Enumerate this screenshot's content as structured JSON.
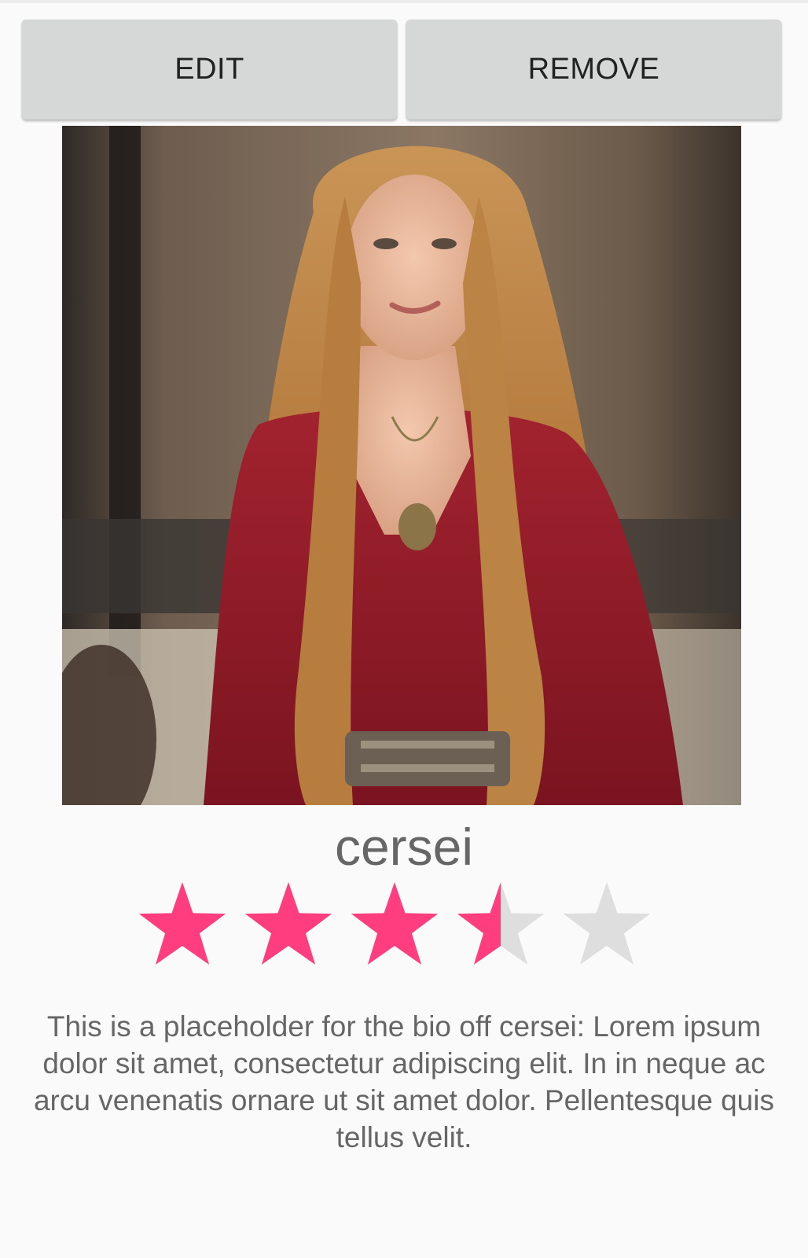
{
  "toolbar": {
    "edit_label": "EDIT",
    "remove_label": "REMOVE"
  },
  "profile": {
    "name": "cersei",
    "photo_icon": "character-portrait-image",
    "rating": {
      "value": 3.5,
      "max": 5,
      "filled_color": "#ff3d7f",
      "empty_color": "#dedede"
    },
    "bio": "This is a placeholder for the bio off cersei: Lorem ipsum dolor sit amet, consectetur adipiscing elit. In in neque ac arcu venenatis ornare ut sit amet dolor. Pellentesque quis tellus velit."
  }
}
